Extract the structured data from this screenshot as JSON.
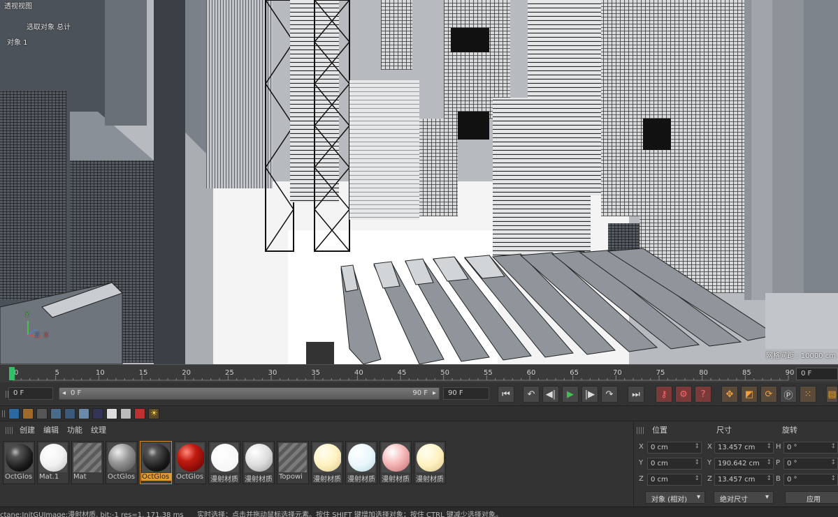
{
  "viewport": {
    "title": "透视视图",
    "hud_line1": "选取对象  总计",
    "hud_line2": "对象   1",
    "grid_info": "网格间距 : 10000 cm",
    "axis_x": "X",
    "axis_y": "Y",
    "axis_z": "Z"
  },
  "timeline": {
    "ticks": [
      "0",
      "5",
      "10",
      "15",
      "20",
      "25",
      "30",
      "35",
      "40",
      "45",
      "50",
      "55",
      "60",
      "65",
      "70",
      "75",
      "80",
      "85",
      "90"
    ],
    "current_frame": "0 F"
  },
  "transport": {
    "start_field": "0 F",
    "range_start": "0 F",
    "range_end": "90 F",
    "end_field": "90 F"
  },
  "materials": {
    "menu": [
      "创建",
      "编辑",
      "功能",
      "纹理"
    ],
    "items": [
      {
        "label": "OctGlos",
        "kind": "dark-gloss"
      },
      {
        "label": "Mat.1",
        "kind": "white"
      },
      {
        "label": "Mat",
        "kind": "striped"
      },
      {
        "label": "OctGlos",
        "kind": "checker"
      },
      {
        "label": "OctGlos",
        "kind": "dark-gloss",
        "selected": true
      },
      {
        "label": "OctGlos",
        "kind": "red"
      },
      {
        "label": "漫射材质",
        "kind": "white-flat"
      },
      {
        "label": "漫射材质",
        "kind": "light-grey"
      },
      {
        "label": "Topowi",
        "kind": "striped"
      },
      {
        "label": "漫射材质",
        "kind": "cream"
      },
      {
        "label": "漫射材质",
        "kind": "pale-cyan"
      },
      {
        "label": "漫射材质",
        "kind": "pink"
      },
      {
        "label": "漫射材质",
        "kind": "cream"
      }
    ]
  },
  "attributes": {
    "headers": {
      "position": "位置",
      "size": "尺寸",
      "rotation": "旋转"
    },
    "rows": [
      {
        "axis": "X",
        "pos": "0 cm",
        "size_axis": "X",
        "size": "13.457 cm",
        "rot_axis": "H",
        "rot": "0 °"
      },
      {
        "axis": "Y",
        "pos": "0 cm",
        "size_axis": "Y",
        "size": "190.642 cm",
        "rot_axis": "P",
        "rot": "0 °"
      },
      {
        "axis": "Z",
        "pos": "0 cm",
        "size_axis": "Z",
        "size": "13.457 cm",
        "rot_axis": "B",
        "rot": "0 °"
      }
    ],
    "coord_mode": "对象 (相对)",
    "size_mode": "绝对尺寸",
    "apply": "应用"
  },
  "status": {
    "left": "ctane:InitGUImage:漫射材质, bit:-1 res=1, 171.38 ms",
    "right": "实时选择：点击并拖动鼠标选择元素。按住 SHIFT 键增加选择对象；按住 CTRL 键减少选择对象。"
  },
  "colors": {
    "accent": "#e29a32",
    "playhead": "#31c06a",
    "play": "#3fbf4f"
  }
}
